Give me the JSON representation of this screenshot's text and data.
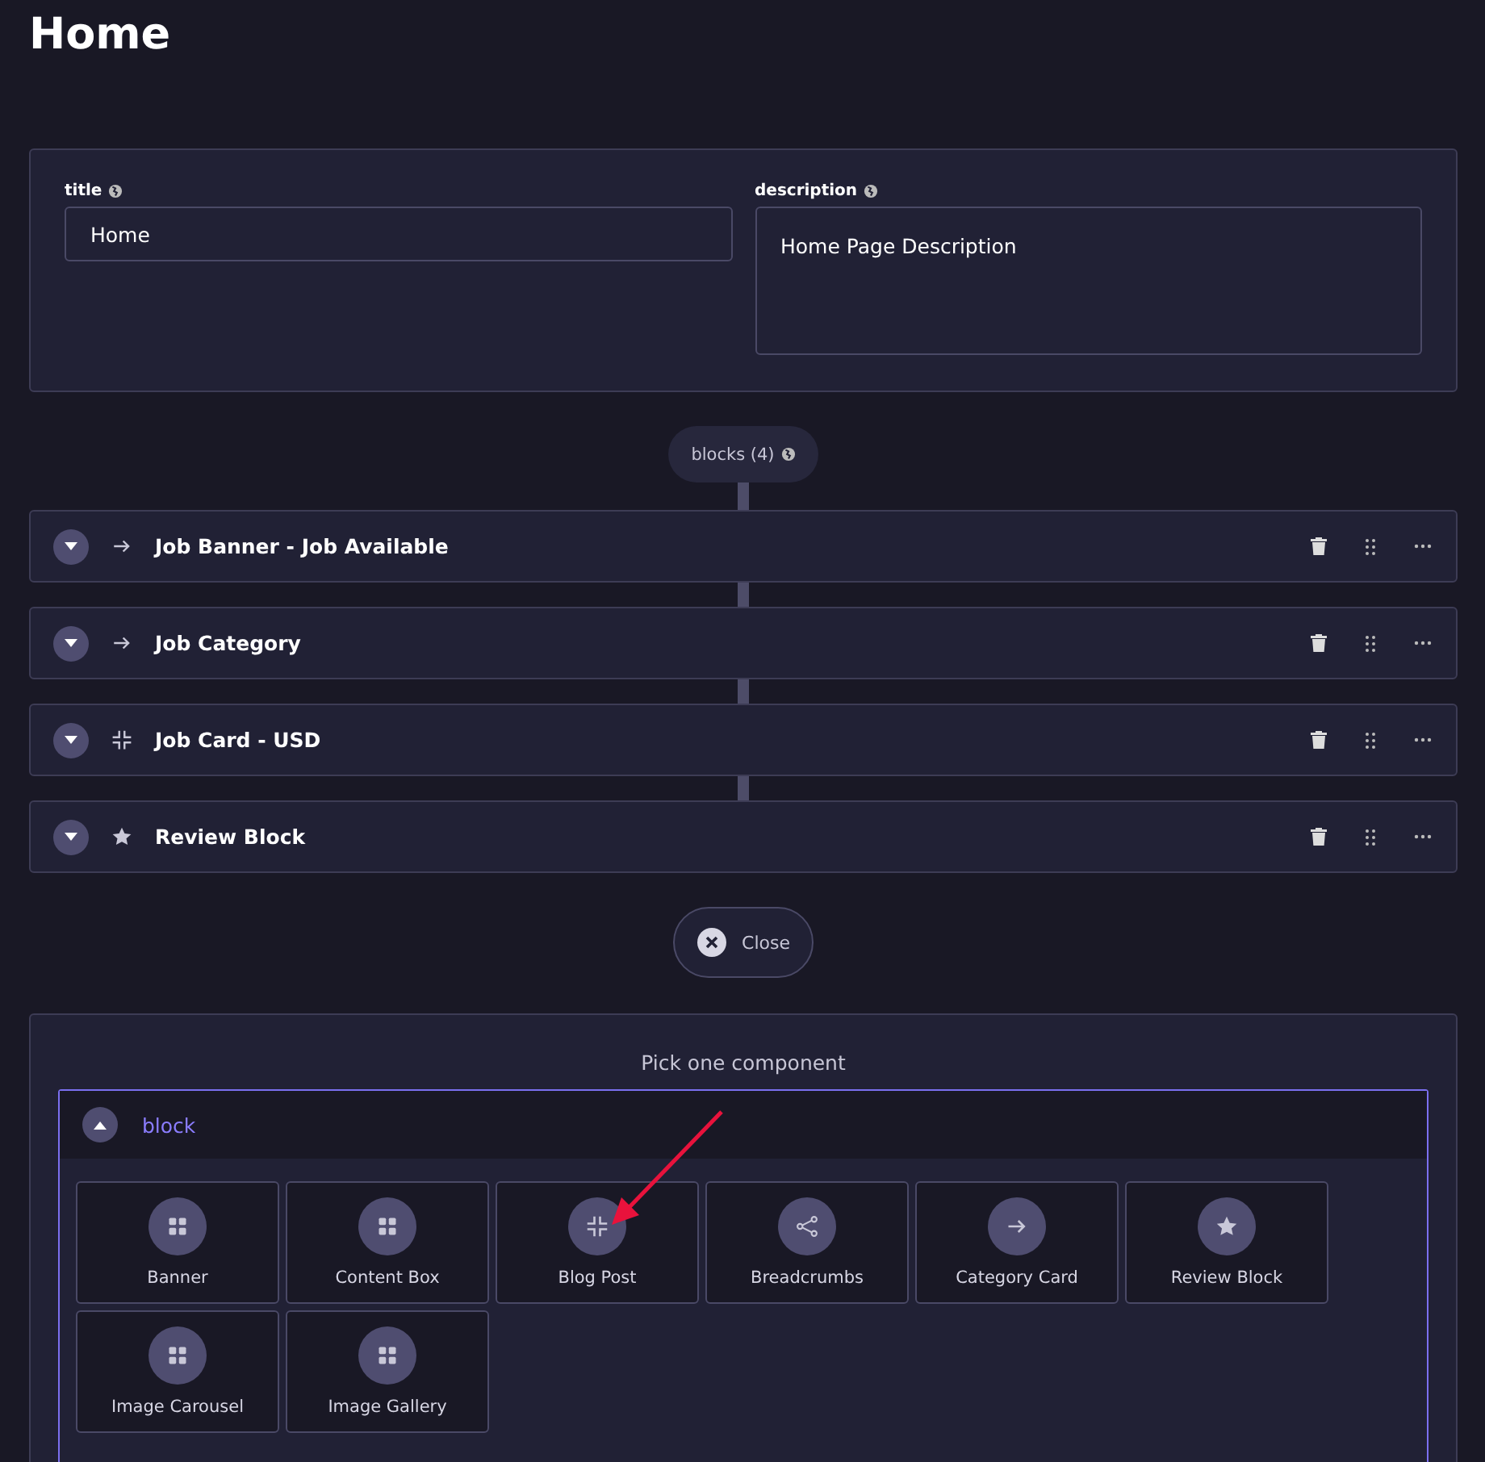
{
  "page_title": "Home",
  "fields": [
    {
      "label": "title",
      "value": "Home",
      "kind": "input"
    },
    {
      "label": "description",
      "value": "Home Page Description",
      "kind": "textarea"
    }
  ],
  "blocks_badge": "blocks (4)",
  "blocks": [
    {
      "name": "Job Banner - Job Available",
      "kind": "arrow",
      "expanded": false
    },
    {
      "name": "Job Category",
      "kind": "arrow",
      "expanded": false
    },
    {
      "name": "Job Card - USD",
      "kind": "shrink",
      "expanded": false
    },
    {
      "name": "Review Block",
      "kind": "star",
      "expanded": false
    }
  ],
  "close_button": "Close",
  "picker": {
    "heading": "Pick one component",
    "group": {
      "label": "block",
      "expanded": true,
      "components": [
        {
          "name": "Banner",
          "kind": "grid"
        },
        {
          "name": "Content Box",
          "kind": "grid"
        },
        {
          "name": "Blog Post",
          "kind": "shrink"
        },
        {
          "name": "Breadcrumbs",
          "kind": "share"
        },
        {
          "name": "Category Card",
          "kind": "arrow"
        },
        {
          "name": "Review Block",
          "kind": "star"
        },
        {
          "name": "Image Carousel",
          "kind": "grid"
        },
        {
          "name": "Image Gallery",
          "kind": "grid"
        }
      ]
    }
  }
}
